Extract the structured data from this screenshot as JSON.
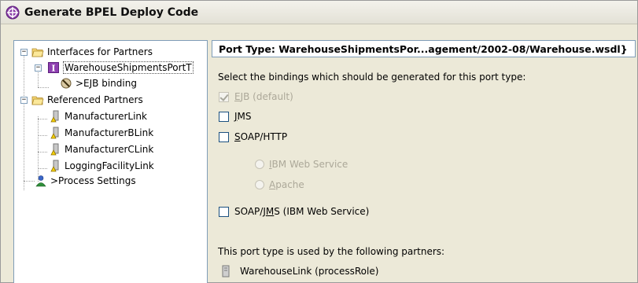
{
  "window": {
    "title": "Generate BPEL Deploy Code"
  },
  "tree": {
    "interfaces_label": "Interfaces for Partners",
    "port_label": "WarehouseShipmentsPortT",
    "ejb_label": ">EJB binding",
    "referenced_label": "Referenced Partners",
    "partners": [
      "ManufacturerLink",
      "ManufacturerBLink",
      "ManufacturerCLink",
      "LoggingFacilityLink"
    ],
    "process_label": ">Process Settings"
  },
  "detail": {
    "header": "Port Type: WarehouseShipmentsPor...agement/2002-08/Warehouse.wsdl}",
    "instructions": "Select the bindings which should be generated for this port type:",
    "ejb": {
      "pre": "",
      "u": "E",
      "post": "JB (default)",
      "checked": true,
      "enabled": false
    },
    "jms": {
      "pre": "",
      "u": "J",
      "post": "MS",
      "checked": false,
      "enabled": true
    },
    "soap_http": {
      "pre": "",
      "u": "S",
      "post": "OAP/HTTP",
      "checked": false,
      "enabled": true
    },
    "ibm_ws": {
      "pre": "",
      "u": "I",
      "post": "BM Web Service",
      "enabled": false
    },
    "apache": {
      "pre": "",
      "u": "A",
      "post": "pache",
      "enabled": false
    },
    "soap_jms": {
      "pre": "SOAP/J",
      "u": "M",
      "post": "S (IBM Web Service)",
      "checked": false,
      "enabled": true
    },
    "used_by_text": "This port type is used by the following partners:",
    "partner_item": "WarehouseLink (processRole)"
  }
}
